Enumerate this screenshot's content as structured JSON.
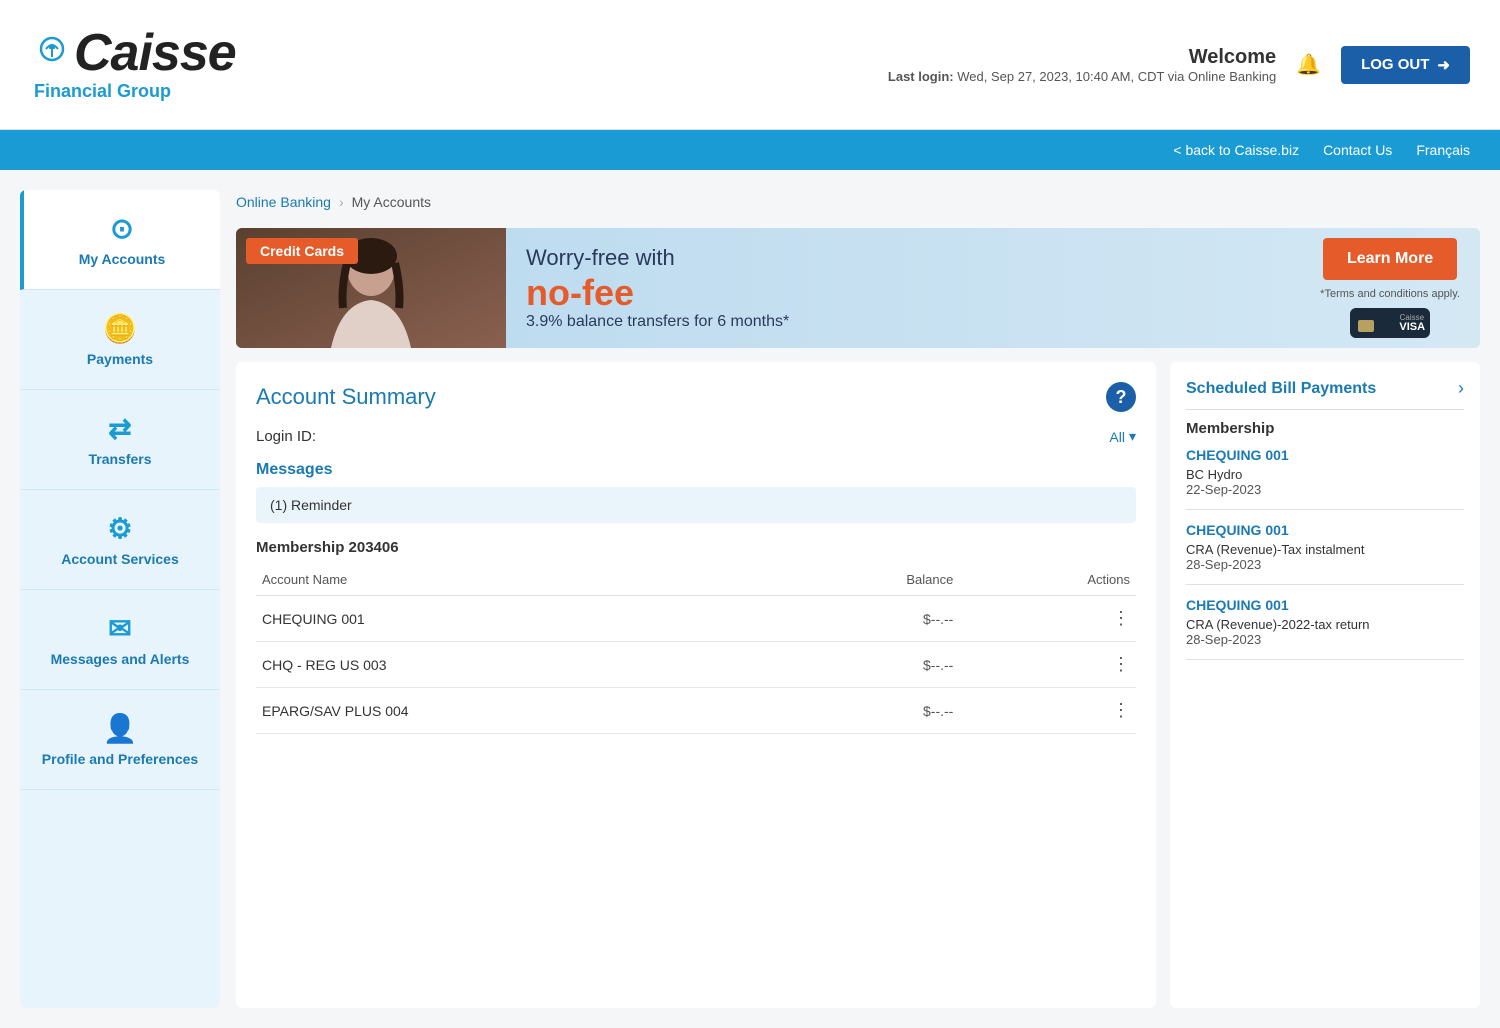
{
  "header": {
    "logo_name": "Caisse",
    "logo_sub": "Financial Group",
    "welcome_label": "Welcome",
    "last_login_label": "Last login:",
    "last_login_value": "Wed, Sep 27, 2023, 10:40 AM, CDT via Online Banking",
    "logout_label": "LOG OUT"
  },
  "top_nav": {
    "back_label": "< back to Caisse.biz",
    "contact_label": "Contact Us",
    "language_label": "Français"
  },
  "sidebar": {
    "items": [
      {
        "id": "my-accounts",
        "label": "My Accounts",
        "icon": "🕹️",
        "active": true
      },
      {
        "id": "payments",
        "label": "Payments",
        "icon": "💰",
        "active": false
      },
      {
        "id": "transfers",
        "label": "Transfers",
        "icon": "🔄",
        "active": false
      },
      {
        "id": "account-services",
        "label": "Account Services",
        "icon": "⚙️",
        "active": false
      },
      {
        "id": "messages-alerts",
        "label": "Messages and Alerts",
        "icon": "✉️",
        "active": false
      },
      {
        "id": "profile-preferences",
        "label": "Profile and Preferences",
        "icon": "👤",
        "active": false
      }
    ]
  },
  "breadcrumb": {
    "home": "Online Banking",
    "current": "My Accounts"
  },
  "banner": {
    "tag": "Credit Cards",
    "title": "Worry-free with",
    "highlight": "no-fee",
    "subtitle": "3.9% balance transfers for 6 months*",
    "terms": "*Terms and conditions apply.",
    "learn_more": "Learn More"
  },
  "account_summary": {
    "title": "Account Summary",
    "login_id_label": "Login ID:",
    "all_label": "All",
    "messages_title": "Messages",
    "message_text": "(1) Reminder",
    "membership_label": "Membership 203406",
    "table_headers": {
      "account_name": "Account Name",
      "balance": "Balance",
      "actions": "Actions"
    },
    "accounts": [
      {
        "name": "CHEQUING 001",
        "balance": "$--.--"
      },
      {
        "name": "CHQ - REG US 003",
        "balance": "$--.--"
      },
      {
        "name": "EPARG/SAV PLUS 004",
        "balance": "$--.--"
      }
    ]
  },
  "scheduled_bills": {
    "title": "Scheduled Bill Payments",
    "membership_label": "Membership",
    "bills": [
      {
        "account": "CHEQUING 001",
        "payee": "BC Hydro",
        "date": "22-Sep-2023"
      },
      {
        "account": "CHEQUING 001",
        "payee": "CRA (Revenue)-Tax instalment",
        "date": "28-Sep-2023"
      },
      {
        "account": "CHEQUING 001",
        "payee": "CRA (Revenue)-2022-tax return",
        "date": "28-Sep-2023"
      }
    ]
  }
}
